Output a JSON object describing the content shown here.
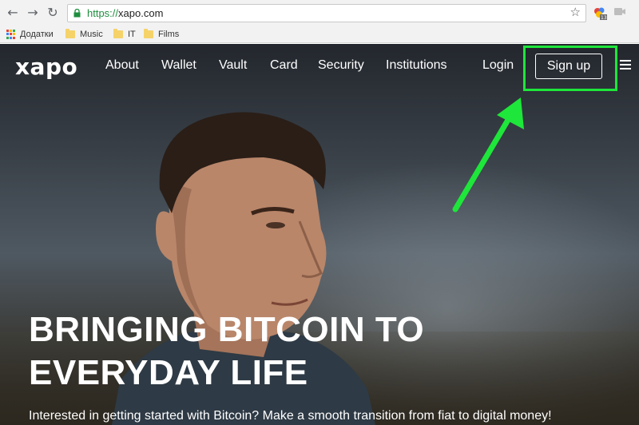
{
  "browser": {
    "back_icon": "←",
    "forward_icon": "→",
    "reload_icon": "↻",
    "url_scheme": "https://",
    "url_host": "xapo.com",
    "star_icon": "☆",
    "bookmarks": [
      {
        "label": "Додатки",
        "icon": "apps-icon"
      },
      {
        "label": "Music",
        "icon": "folder-icon"
      },
      {
        "label": "IT",
        "icon": "folder-icon"
      },
      {
        "label": "Films",
        "icon": "folder-icon"
      }
    ]
  },
  "site": {
    "logo": "xapo",
    "nav": [
      "About",
      "Wallet",
      "Vault",
      "Card",
      "Security",
      "Institutions"
    ],
    "login": "Login",
    "signup": "Sign up",
    "headline_line1": "BRINGING BITCOIN TO",
    "headline_line2": "EVERYDAY LIFE",
    "subline": "Interested in getting started with Bitcoin? Make a smooth transition from fiat to digital money!"
  },
  "annotation": {
    "color": "#1ee63a"
  },
  "colors": {
    "chrome_bg": "#f2f2f2",
    "secure_green": "#1e8e3e",
    "hero_text": "#ffffff"
  }
}
